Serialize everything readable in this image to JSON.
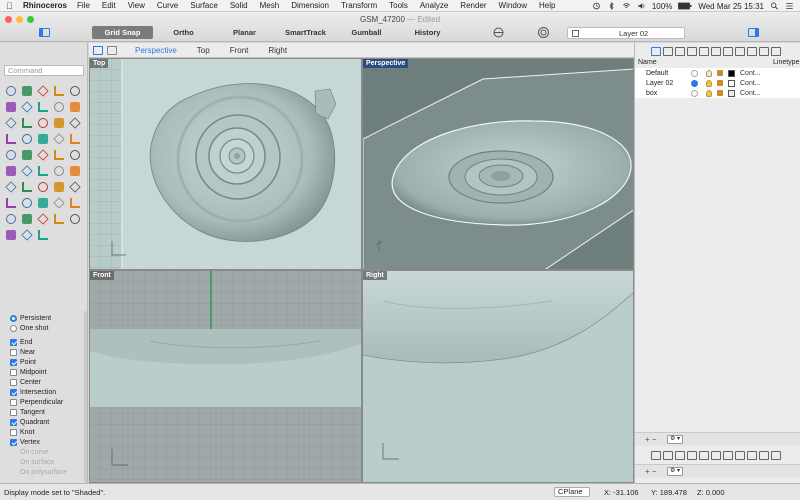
{
  "menubar": {
    "app": "Rhinoceros",
    "items": [
      "File",
      "Edit",
      "View",
      "Curve",
      "Surface",
      "Solid",
      "Mesh",
      "Dimension",
      "Transform",
      "Tools",
      "Analyze",
      "Render",
      "Window",
      "Help"
    ],
    "battery": "100%",
    "clock": "Wed Mar 25  15:31"
  },
  "window": {
    "title": "GSM_47200",
    "edited": "— Edited"
  },
  "toolbar": {
    "modes": [
      "Grid Snap",
      "Ortho",
      "Planar",
      "SmartTrack",
      "Gumball",
      "History"
    ],
    "active_mode": "Grid Snap",
    "current_layer": "Layer 02"
  },
  "command": {
    "placeholder": "Command"
  },
  "tools": {
    "icons": [
      "select-arrow-icon",
      "point-icon",
      "curve-icon",
      "line-icon",
      "arc-icon",
      "polyline-icon",
      "circle-icon",
      "ellipse-icon",
      "rectangle-icon",
      "polygon-icon",
      "fillet-icon",
      "offset-icon",
      "box-icon",
      "sphere-icon",
      "cylinder-icon",
      "surface-icon",
      "extrude-icon",
      "loft-icon",
      "revolve-icon",
      "sweep-icon",
      "trim-icon",
      "split-icon",
      "join-icon",
      "explode-icon",
      "text-icon",
      "boolean-icon",
      "mesh-icon",
      "cage-icon",
      "dimension-icon",
      "transform-icon",
      "array-icon",
      "layer-icon",
      "properties-icon",
      "check-icon",
      "zoom-icon",
      "render-icon",
      "material-icon",
      "light-icon",
      "camera-icon",
      "group-icon",
      "edit-points-icon",
      "hide-icon",
      "lock-icon",
      "color-icon",
      "analyze-icon",
      "globe-icon",
      "grid-icon",
      "snap-icon"
    ]
  },
  "snaps": {
    "modes": [
      {
        "label": "Persistent",
        "on": true
      },
      {
        "label": "One shot",
        "on": false
      }
    ],
    "items": [
      {
        "label": "End",
        "on": true,
        "disabled": false
      },
      {
        "label": "Near",
        "on": false,
        "disabled": false
      },
      {
        "label": "Point",
        "on": true,
        "disabled": false
      },
      {
        "label": "Midpoint",
        "on": false,
        "disabled": false
      },
      {
        "label": "Center",
        "on": false,
        "disabled": false
      },
      {
        "label": "Intersection",
        "on": true,
        "disabled": false
      },
      {
        "label": "Perpendicular",
        "on": false,
        "disabled": false
      },
      {
        "label": "Tangent",
        "on": false,
        "disabled": false
      },
      {
        "label": "Quadrant",
        "on": true,
        "disabled": false
      },
      {
        "label": "Knot",
        "on": false,
        "disabled": false
      },
      {
        "label": "Vertex",
        "on": true,
        "disabled": false
      },
      {
        "label": "On curve",
        "on": false,
        "disabled": true
      },
      {
        "label": "On surface",
        "on": false,
        "disabled": true
      },
      {
        "label": "On polysurface",
        "on": false,
        "disabled": true
      }
    ]
  },
  "viewport_tabs": {
    "tabs": [
      "Perspective",
      "Top",
      "Front",
      "Right"
    ],
    "active": "Perspective"
  },
  "viewports": {
    "top": "Top",
    "perspective": "Perspective",
    "front": "Front",
    "right": "Right"
  },
  "layers": {
    "headers": {
      "name": "Name",
      "linetype": "Linetype"
    },
    "rows": [
      {
        "name": "Default",
        "current": false,
        "bulb": "#e8e8e8",
        "swatch": "#000000",
        "linetype": "Cont..."
      },
      {
        "name": "Layer 02",
        "current": true,
        "bulb": "#f2c53d",
        "swatch": "#ffffff",
        "linetype": "Cont..."
      },
      {
        "name": "box",
        "current": false,
        "bulb": "#f2c53d",
        "swatch": "#e0f0ee",
        "linetype": "Cont..."
      }
    ],
    "add_remove": "+  −"
  },
  "status": {
    "message": "Display mode set to \"Shaded\".",
    "cplane": "CPlane",
    "x": "X: -31.106",
    "y": "Y: 189.478",
    "z": "Z: 0.000"
  },
  "colors": {
    "accent": "#2a7be4",
    "viewport_bg": "#b7cdcb",
    "grid": "#8e9a9a",
    "active_label": "#2b4d7c"
  }
}
